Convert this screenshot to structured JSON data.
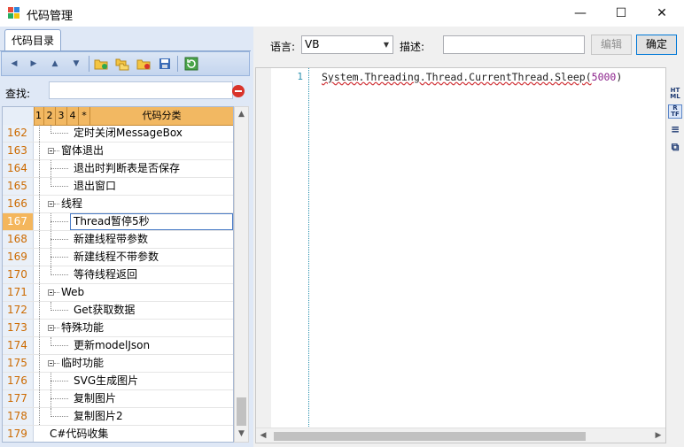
{
  "window": {
    "title": "代码管理",
    "minimize": "—",
    "maximize": "☐",
    "close": "✕"
  },
  "left": {
    "tab": "代码目录",
    "search_label": "查找:",
    "grid": {
      "headers": [
        "1",
        "2",
        "3",
        "4",
        "*",
        "代码分类"
      ],
      "rows": [
        {
          "n": "162",
          "text": "定时关闭MessageBox",
          "level": 2
        },
        {
          "n": "163",
          "text": "窗体退出",
          "level": 1
        },
        {
          "n": "164",
          "text": "退出时判断表是否保存",
          "level": 2
        },
        {
          "n": "165",
          "text": "退出窗口",
          "level": 2
        },
        {
          "n": "166",
          "text": "线程",
          "level": 1
        },
        {
          "n": "167",
          "text": "Thread暂停5秒",
          "level": 2,
          "selected": true
        },
        {
          "n": "168",
          "text": "新建线程带参数",
          "level": 2
        },
        {
          "n": "169",
          "text": "新建线程不带参数",
          "level": 2
        },
        {
          "n": "170",
          "text": "等待线程返回",
          "level": 2
        },
        {
          "n": "171",
          "text": "Web",
          "level": 1
        },
        {
          "n": "172",
          "text": "Get获取数据",
          "level": 2
        },
        {
          "n": "173",
          "text": "特殊功能",
          "level": 1
        },
        {
          "n": "174",
          "text": "更新modelJson",
          "level": 2
        },
        {
          "n": "175",
          "text": "临时功能",
          "level": 1
        },
        {
          "n": "176",
          "text": "SVG生成图片",
          "level": 2
        },
        {
          "n": "177",
          "text": "复制图片",
          "level": 2
        },
        {
          "n": "178",
          "text": "复制图片2",
          "level": 2
        },
        {
          "n": "179",
          "text": "C#代码收集",
          "level": 0
        }
      ]
    }
  },
  "right": {
    "lang_label": "语言:",
    "lang_value": "VB",
    "desc_label": "描述:",
    "desc_value": "",
    "edit_button": "编辑",
    "ok_button": "确定",
    "editor": {
      "line_number": "1",
      "code_prefix": "System.Threading.Thread.CurrentThread.Sleep(",
      "code_number": "5000",
      "code_suffix": ")"
    },
    "side_icons": [
      {
        "name": "html-icon",
        "label": "HT\nML"
      },
      {
        "name": "rtf-icon",
        "label": "R\nTF"
      },
      {
        "name": "list-icon",
        "label": "≡"
      },
      {
        "name": "copy-icon",
        "label": "⧉"
      }
    ]
  },
  "colors": {
    "accent": "#f2b862",
    "row_number": "#cc6a00",
    "line_number": "#2b91af",
    "code_number": "#8a1f8a"
  }
}
